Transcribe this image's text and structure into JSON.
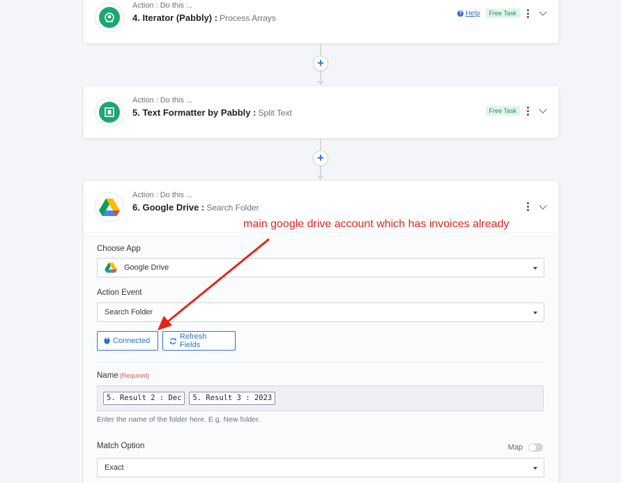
{
  "steps": [
    {
      "action_label": "Action : Do this ...",
      "title": "4. Iterator (Pabbly) :",
      "subtitle": "Process Arrays",
      "help": "Help",
      "badge": "Free Task"
    },
    {
      "action_label": "Action : Do this ...",
      "title": "5. Text Formatter by Pabbly :",
      "subtitle": "Split Text",
      "badge": "Free Task"
    },
    {
      "action_label": "Action : Do this ...",
      "title": "6. Google Drive :",
      "subtitle": "Search Folder"
    }
  ],
  "form": {
    "choose_app_label": "Choose App",
    "choose_app_value": "Google Drive",
    "action_event_label": "Action Event",
    "action_event_value": "Search Folder",
    "connected_button": "Connected",
    "refresh_button": "Refresh Fields",
    "name_label": "Name",
    "name_required": "(Required)",
    "name_chips": [
      "5. Result 2 : Dec",
      "5. Result 3 : 2023"
    ],
    "name_hint": "Enter the name of the folder here. E.g. New folder.",
    "match_label": "Match Option",
    "map_label": "Map",
    "match_value": "Exact"
  },
  "annotation": "main google drive account which has invoices already",
  "colors": {
    "accent": "#2e6fdb",
    "pabbly_green": "#1ba672",
    "annotation_red": "#e8231a",
    "badge_bg": "#dff6ea"
  },
  "icons": {
    "step4": "iterator-icon",
    "step5": "text-formatter-icon",
    "step6": "google-drive-icon"
  }
}
